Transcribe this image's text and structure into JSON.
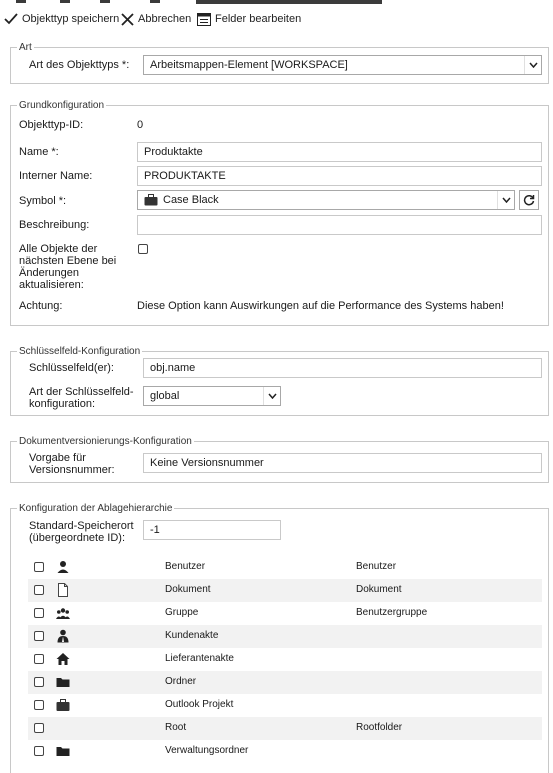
{
  "toolbar": {
    "save_label": "Objekttyp speichern",
    "cancel_label": "Abbrechen",
    "edit_fields_label": "Felder bearbeiten"
  },
  "art": {
    "legend": "Art",
    "type_label": "Art des Objekttyps *:",
    "type_value": "Arbeitsmappen-Element [WORKSPACE]"
  },
  "grund": {
    "legend": "Grundkonfiguration",
    "id_label": "Objekttyp-ID:",
    "id_value": "0",
    "name_label": "Name *:",
    "name_value": "Produktakte",
    "internal_label": "Interner Name:",
    "internal_value": "PRODUKTAKTE",
    "symbol_label": "Symbol *:",
    "symbol_value": "Case Black",
    "desc_label": "Beschreibung:",
    "desc_value": "",
    "update_label_1": "Alle Objekte der",
    "update_label_2": "nächsten Ebene bei",
    "update_label_3": "Änderungen",
    "update_label_4": "aktualisieren:",
    "warn_label": "Achtung:",
    "warn_text": "Diese Option kann Auswirkungen auf die Performance des Systems haben!"
  },
  "key": {
    "legend": "Schlüsselfeld-Konfiguration",
    "fields_label": "Schlüsselfeld(er):",
    "fields_value": "obj.name",
    "type_label_1": "Art der Schlüsselfeld-",
    "type_label_2": "konfiguration:",
    "type_value": "global"
  },
  "ver": {
    "legend": "Dokumentversionierungs-Konfiguration",
    "label_1": "Vorgabe für",
    "label_2": "Versionsnummer:",
    "value": "Keine Versionsnummer"
  },
  "hier": {
    "legend": "Konfiguration der Ablagehierarchie",
    "store_label_1": "Standard-Speicherort",
    "store_label_2": "(übergeordnete ID):",
    "store_value": "-1",
    "rows": [
      {
        "icon": "user-icon",
        "name": "Benutzer",
        "alias": "Benutzer"
      },
      {
        "icon": "document-icon",
        "name": "Dokument",
        "alias": "Dokument"
      },
      {
        "icon": "group-icon",
        "name": "Gruppe",
        "alias": "Benutzergruppe"
      },
      {
        "icon": "customer-icon",
        "name": "Kundenakte",
        "alias": ""
      },
      {
        "icon": "house-icon",
        "name": "Lieferantenakte",
        "alias": ""
      },
      {
        "icon": "folder-icon",
        "name": "Ordner",
        "alias": ""
      },
      {
        "icon": "briefcase-icon",
        "name": "Outlook Projekt",
        "alias": ""
      },
      {
        "icon": "",
        "name": "Root",
        "alias": "Rootfolder"
      },
      {
        "icon": "folder-icon",
        "name": "Verwaltungsordner",
        "alias": ""
      }
    ]
  }
}
